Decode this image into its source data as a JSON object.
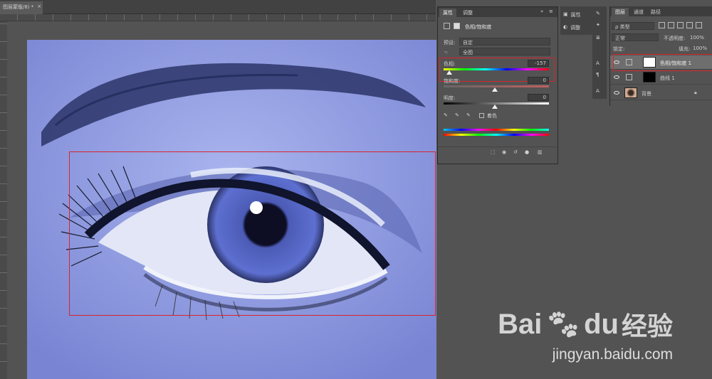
{
  "document": {
    "tab_title": "图层蒙版/8) *",
    "close_glyph": "×"
  },
  "properties": {
    "tabs": [
      "属性",
      "调整"
    ],
    "menu_glyph": "≡",
    "collapse_glyph": "»",
    "title": "色相/饱和度",
    "preset_label": "预设:",
    "preset_value": "自定",
    "channel_value": "全图",
    "hue_label": "色相:",
    "hue_value": "-157",
    "saturation_label": "饱和度:",
    "saturation_value": "0",
    "lightness_label": "明度:",
    "lightness_value": "0",
    "colorize_label": "着色"
  },
  "side_strip": {
    "items": [
      {
        "label": "属性",
        "icon": "properties-icon"
      },
      {
        "label": "调整",
        "icon": "adjustments-icon"
      }
    ]
  },
  "layers_panel": {
    "tabs": [
      "图层",
      "通道",
      "路径"
    ],
    "filter_value": "ρ 类型",
    "blend_mode": "正常",
    "opacity_label": "不透明度:",
    "opacity_value": "100%",
    "lock_label": "锁定:",
    "fill_label": "填充:",
    "fill_value": "100%",
    "layers": [
      {
        "name": "色相/饱和度 1",
        "selected": true,
        "mask": "white"
      },
      {
        "name": "曲线 1",
        "selected": false,
        "mask": "black"
      },
      {
        "name": "背景",
        "selected": false,
        "mask": "photo"
      }
    ]
  },
  "watermark": {
    "brand": "Bai",
    "brand2": "du",
    "cn": "经验",
    "url": "jingyan.baidu.com"
  },
  "colors": {
    "highlight": "#d8242c",
    "panel": "#535353",
    "canvas_bg": "#535353"
  }
}
